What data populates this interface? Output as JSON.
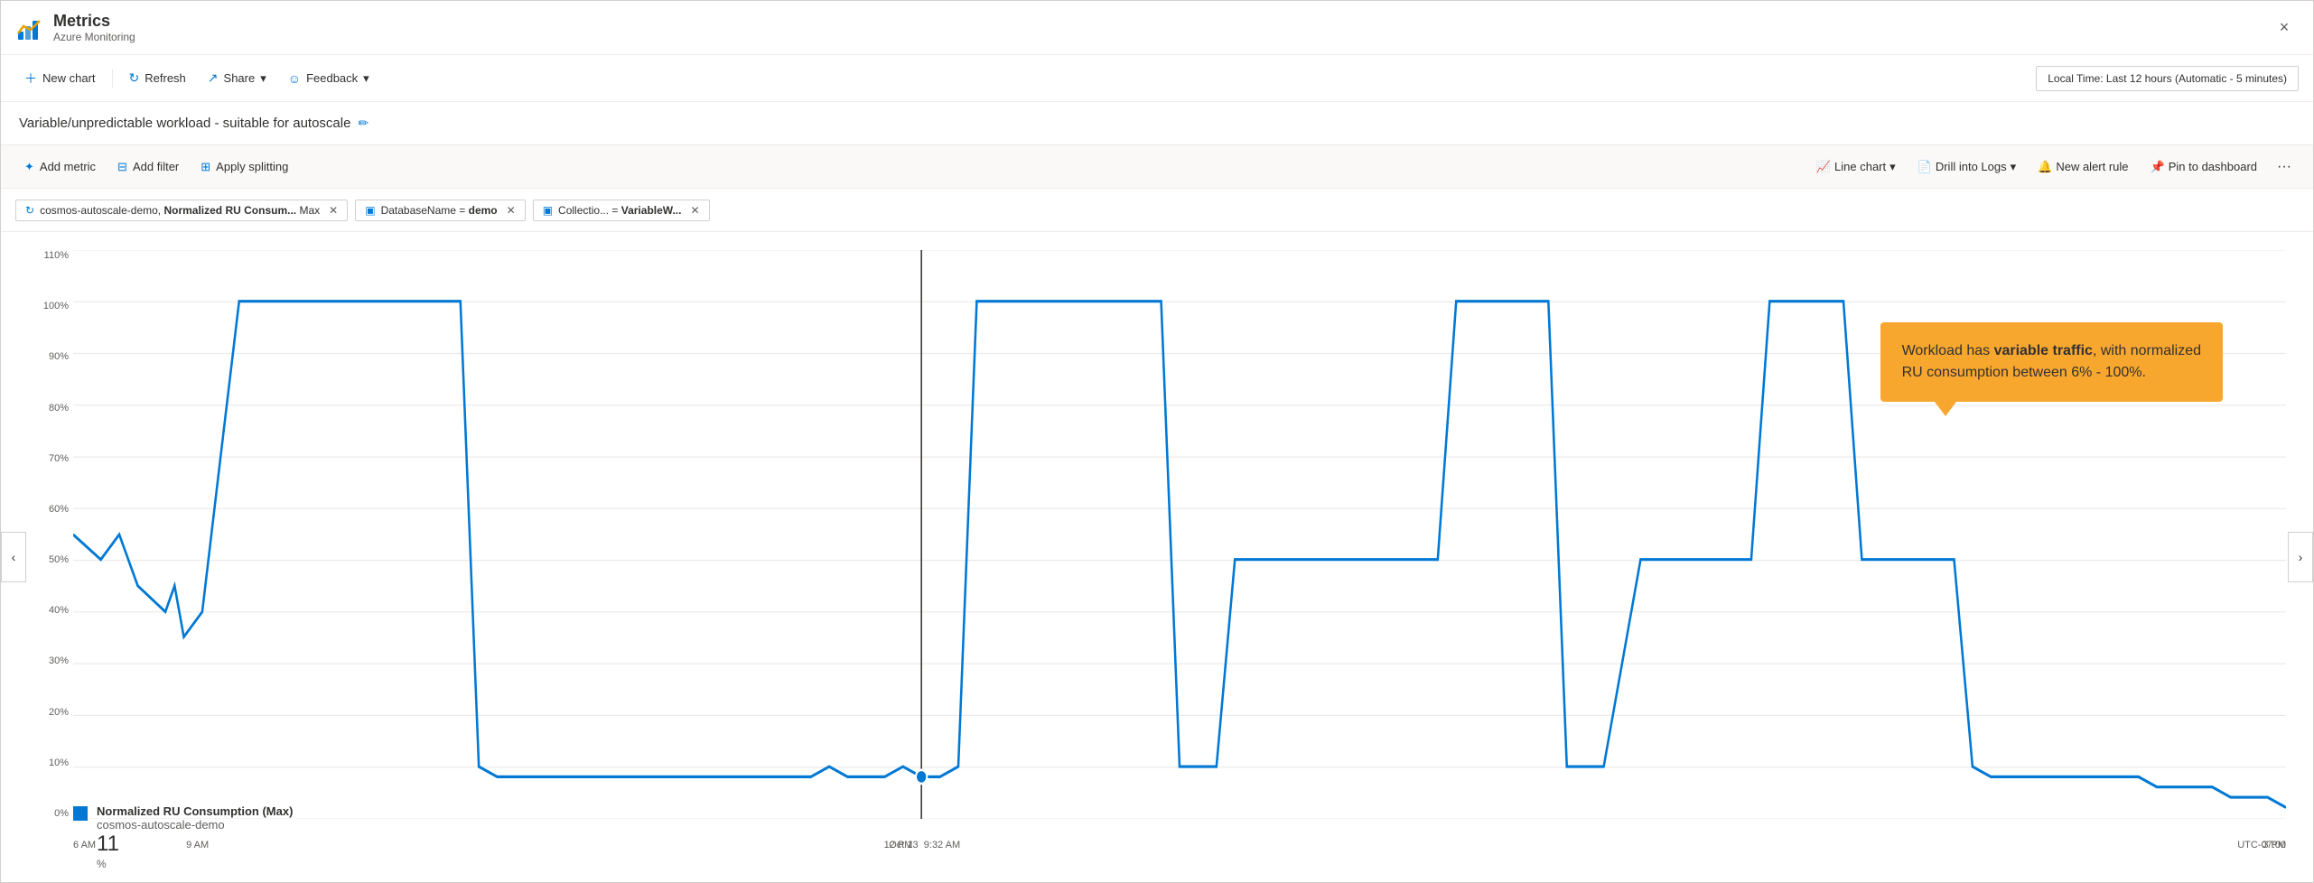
{
  "app": {
    "title": "Metrics",
    "subtitle": "Azure Monitoring",
    "close_label": "×"
  },
  "toolbar": {
    "new_chart": "New chart",
    "refresh": "Refresh",
    "share": "Share",
    "feedback": "Feedback",
    "time_selector": "Local Time: Last 12 hours (Automatic - 5 minutes)"
  },
  "chart_title": "Variable/unpredictable workload - suitable for autoscale",
  "metric_toolbar": {
    "add_metric": "Add metric",
    "add_filter": "Add filter",
    "apply_splitting": "Apply splitting",
    "line_chart": "Line chart",
    "drill_into_logs": "Drill into Logs",
    "new_alert_rule": "New alert rule",
    "pin_to_dashboard": "Pin to dashboard",
    "more": "···"
  },
  "filters": [
    {
      "icon": "↻",
      "text_normal": "cosmos-autoscale-demo, ",
      "text_bold": "Normalized RU Consum...",
      "text_suffix": " Max"
    },
    {
      "icon": "⊟",
      "text_normal": "DatabaseName = ",
      "text_bold": "demo"
    },
    {
      "icon": "⊟",
      "text_normal": "Collectio... = ",
      "text_bold": "VariableW..."
    }
  ],
  "chart": {
    "y_labels": [
      "110%",
      "100%",
      "90%",
      "80%",
      "70%",
      "60%",
      "50%",
      "40%",
      "30%",
      "20%",
      "10%",
      "0%"
    ],
    "x_labels": [
      "6 AM",
      "9 AM",
      "Oct 13  9:32 AM",
      "12 PM",
      "3 PM"
    ],
    "utc_label": "UTC-07:00",
    "cursor_time": "Oct 13  9:32 AM"
  },
  "callout": {
    "text_normal": "Workload has ",
    "text_bold": "variable traffic",
    "text_suffix": ", with normalized\nRU consumption between 6% - 100%."
  },
  "legend": {
    "title": "Normalized RU Consumption (Max)",
    "subtitle": "cosmos-autoscale-demo",
    "value": "11",
    "unit": "%"
  },
  "nav": {
    "left": "‹",
    "right": "›"
  }
}
